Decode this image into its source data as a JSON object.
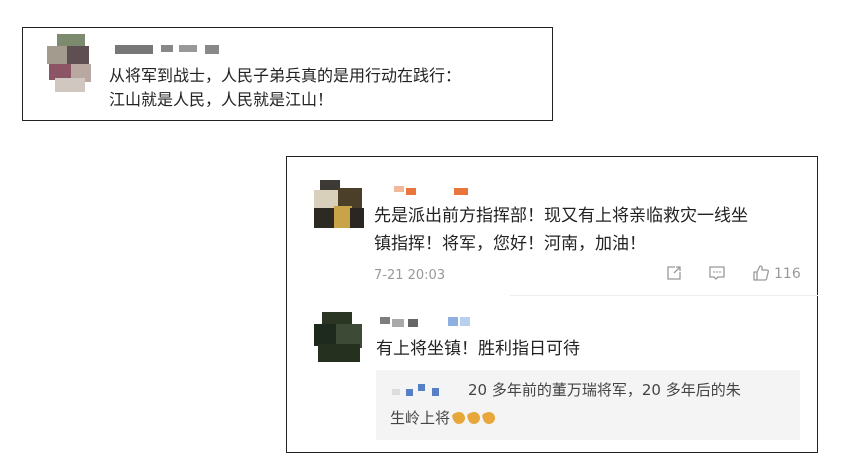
{
  "posts": [
    {
      "lines": [
        "从将军到战士，人民子弟兵真的是用行动在践行：",
        "江山就是人民，人民就是江山！"
      ]
    },
    {
      "lines": [
        "先是派出前方指挥部！现又有上将亲临救灾一线坐",
        "镇指挥！将军，您好！河南，加油！"
      ],
      "time": "7-21 20:03",
      "like_count": "116"
    }
  ],
  "reply": {
    "text": "有上将坐镇！胜利指日可待",
    "quote_lines": [
      "20 多年前的董万瑞将军，20 多年后的朱",
      "生岭上将"
    ]
  },
  "icons": [
    "share-icon",
    "comment-icon",
    "like-icon",
    "flexed-biceps-emoji"
  ],
  "colors": {
    "text": "#222222",
    "meta": "#999999",
    "quote_bg": "#f4f4f4",
    "accent": "#e8a73a"
  }
}
